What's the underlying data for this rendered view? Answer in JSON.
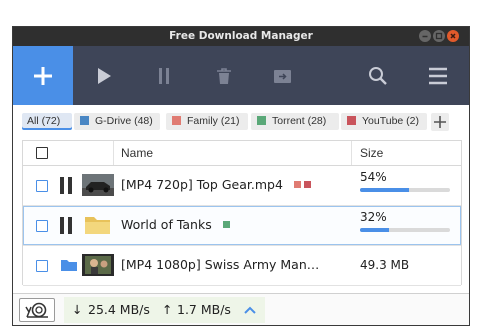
{
  "app": {
    "title": "Free Download Manager",
    "accent": "#4a8fe7"
  },
  "toolbar": {
    "buttons": [
      {
        "icon": "plus-icon",
        "label": "Add"
      },
      {
        "icon": "play-icon",
        "label": "Start"
      },
      {
        "icon": "pause-icon",
        "label": "Pause"
      },
      {
        "icon": "trash-icon",
        "label": "Delete"
      },
      {
        "icon": "move-icon",
        "label": "Move"
      },
      {
        "icon": "search-icon",
        "label": "Search"
      },
      {
        "icon": "menu-icon",
        "label": "Menu"
      }
    ]
  },
  "filters": {
    "chips": [
      {
        "label": "All (72)",
        "color": "",
        "active": true
      },
      {
        "label": "G-Drive (48)",
        "color": "#4a87c4",
        "active": false
      },
      {
        "label": "Family (21)",
        "color": "#e07b72",
        "active": false
      },
      {
        "label": "Torrent (28)",
        "color": "#5aa878",
        "active": false
      },
      {
        "label": "YouTube (2)",
        "color": "#c9545c",
        "active": false
      }
    ]
  },
  "table": {
    "columns": [
      "Name",
      "Size"
    ],
    "rows": [
      {
        "name": "[MP4 720p] Top Gear.mp4",
        "tags": [
          "#e07b72",
          "#c9545c"
        ],
        "state": "paused",
        "progress_text": "54%",
        "progress": 0.54,
        "size": ""
      },
      {
        "name": "World of Tanks",
        "tags": [
          "#5aa878"
        ],
        "state": "paused",
        "progress_text": "32%",
        "progress": 0.32,
        "size": ""
      },
      {
        "name": "[MP4 1080p] Swiss Army Man…",
        "tags": [],
        "state": "completed",
        "progress_text": "",
        "progress": 1,
        "size": "49.3 MB"
      }
    ]
  },
  "status": {
    "download_speed": "25.4 MB/s",
    "upload_speed": "1.7 MB/s"
  }
}
